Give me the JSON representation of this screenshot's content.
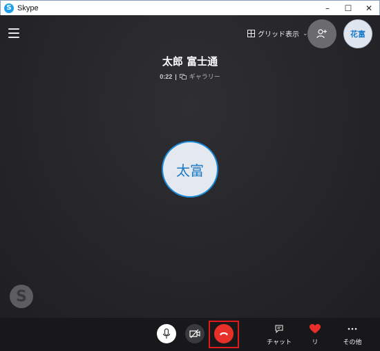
{
  "window": {
    "title": "Skype",
    "app_icon_letter": "S",
    "minimize": "–",
    "maximize": "☐",
    "close": "✕"
  },
  "header": {
    "grid_view_label": "グリッド表示",
    "self_avatar_initials": "花富"
  },
  "call": {
    "callee_name": "太郎 富士通",
    "timer": "0:22",
    "separator": "|",
    "view_mode": "ギャラリー",
    "callee_initials": "太富"
  },
  "watermark": {
    "letter": "S"
  },
  "controls": {
    "chat_label": "チャット",
    "react_label": "リ",
    "more_label": "その他"
  },
  "colors": {
    "accent": "#1a8ad8",
    "hangup": "#e8302a",
    "highlight": "#e11b1b",
    "heart": "#e8302a"
  }
}
